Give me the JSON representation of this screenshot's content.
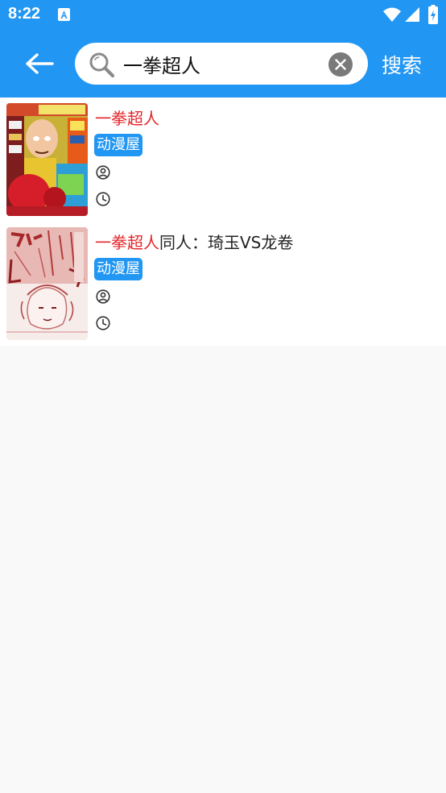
{
  "status_bar": {
    "time": "8:22",
    "icons": [
      "a-notification-icon",
      "wifi-icon",
      "signal-icon",
      "battery-icon"
    ]
  },
  "header": {
    "search": {
      "value": "一拳超人",
      "placeholder": ""
    },
    "submit_label": "搜索"
  },
  "results": [
    {
      "title_highlight": "一拳超人",
      "title_rest": "",
      "source": "动漫屋",
      "author": "",
      "updated": ""
    },
    {
      "title_highlight": "一拳超人",
      "title_rest": "同人：琦玉VS龙卷",
      "source": "动漫屋",
      "author": "",
      "updated": ""
    }
  ],
  "colors": {
    "primary": "#2196f3",
    "highlight": "#e5252a",
    "background": "#f9f9f9"
  }
}
